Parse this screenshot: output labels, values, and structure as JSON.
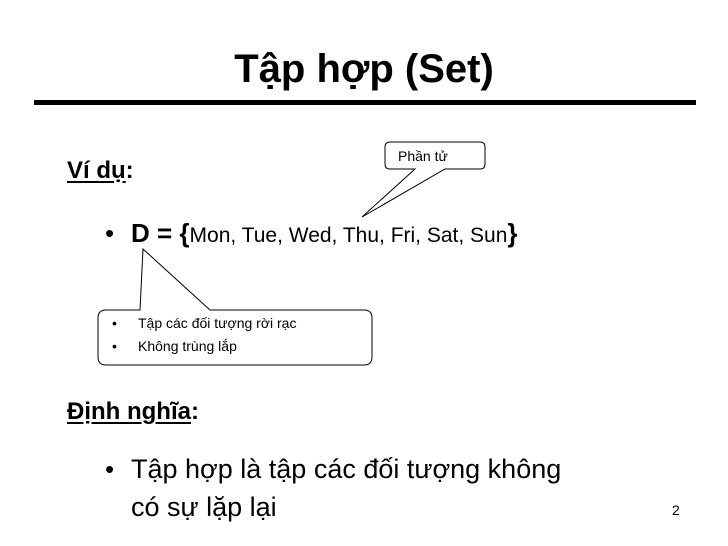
{
  "slide": {
    "title": "Tập hợp (Set)",
    "example_heading": "Ví dụ",
    "example_colon": ":",
    "set_bullet": "•",
    "set_label": "D = {",
    "set_elements": "Mon, Tue, Wed, Thu, Fri, Sat, Sun",
    "set_close": "}",
    "callout_element": "Phần tử",
    "callout_bullets": [
      {
        "dot": "•",
        "text": "Tập các đối tượng rời rạc"
      },
      {
        "dot": "•",
        "text": "Không trùng lắp"
      }
    ],
    "definition_heading": "Định nghĩa",
    "definition_colon": ":",
    "definition_bullet": "•",
    "definition_line1": "Tập hợp là tập các đối tượng không",
    "definition_line2": "có sự lặp lại",
    "page_number": "2"
  }
}
